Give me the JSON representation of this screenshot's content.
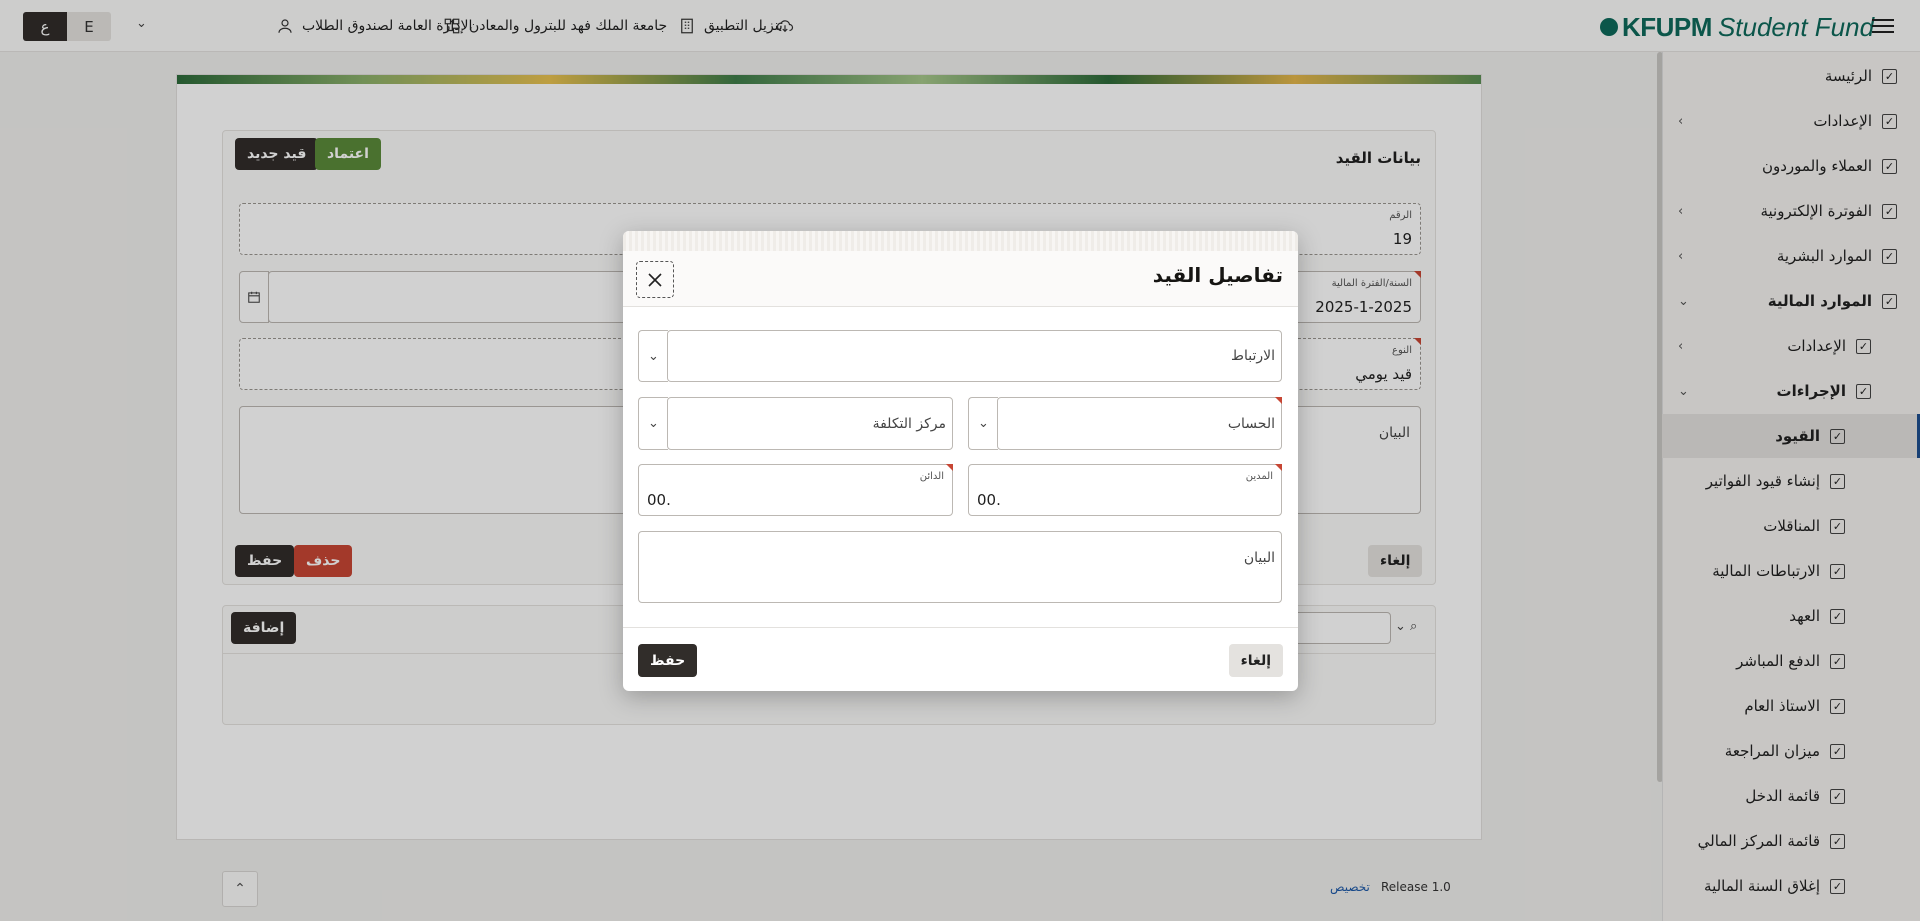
{
  "topbar": {
    "lang_ar": "ع",
    "lang_en": "E",
    "download": "تنزيل التطبيق",
    "university": "جامعة الملك فهد للبترول والمعادن",
    "department": "الإدارة العامة لصندوق الطلاب",
    "logo_bold": "KFUPM",
    "logo_rest": "Student Fund"
  },
  "sidebar": {
    "items": [
      {
        "label": "الرئيسة"
      },
      {
        "label": "الإعدادات"
      },
      {
        "label": "العملاء والموردون"
      },
      {
        "label": "الفوترة الإلكترونية"
      },
      {
        "label": "الموارد البشرية"
      },
      {
        "label": "الموارد المالية"
      },
      {
        "label": "الإعدادات"
      },
      {
        "label": "الإجراءات"
      },
      {
        "label": "القيود"
      },
      {
        "label": "إنشاء قيود الفواتير"
      },
      {
        "label": "المناقلات"
      },
      {
        "label": "الارتباطات المالية"
      },
      {
        "label": "العهد"
      },
      {
        "label": "الدفع المباشر"
      },
      {
        "label": "الاستاذ العام"
      },
      {
        "label": "ميزان المراجعة"
      },
      {
        "label": "قائمة الدخل"
      },
      {
        "label": "قائمة المركز المالي"
      },
      {
        "label": "إغلاق السنة المالية"
      }
    ]
  },
  "entry_card": {
    "title": "بيانات القيد",
    "new_button": "قيد جديد",
    "approve_button": "اعتماد",
    "number_label": "الرقم",
    "number_value": "19",
    "period_label": "السنة/الفترة المالية",
    "period_value": "2025-1-2025",
    "type_label": "النوع",
    "type_value": "قيد يومي",
    "description_label": "البيان",
    "save_button": "حفظ",
    "delete_button": "حذف",
    "cancel_button": "إلغاء"
  },
  "lines_card": {
    "add_button": "إضافة"
  },
  "footer": {
    "customize": "تخصيص",
    "release": "Release 1.0"
  },
  "dialog": {
    "title": "تفاصيل القيد",
    "link_placeholder": "الارتباط",
    "cost_center_placeholder": "مركز التكلفة",
    "account_placeholder": "الحساب",
    "credit_label": "الدائن",
    "credit_value": "00.",
    "debit_label": "المدين",
    "debit_value": "00.",
    "description_placeholder": "البيان",
    "save_button": "حفظ",
    "cancel_button": "إلغاء"
  }
}
